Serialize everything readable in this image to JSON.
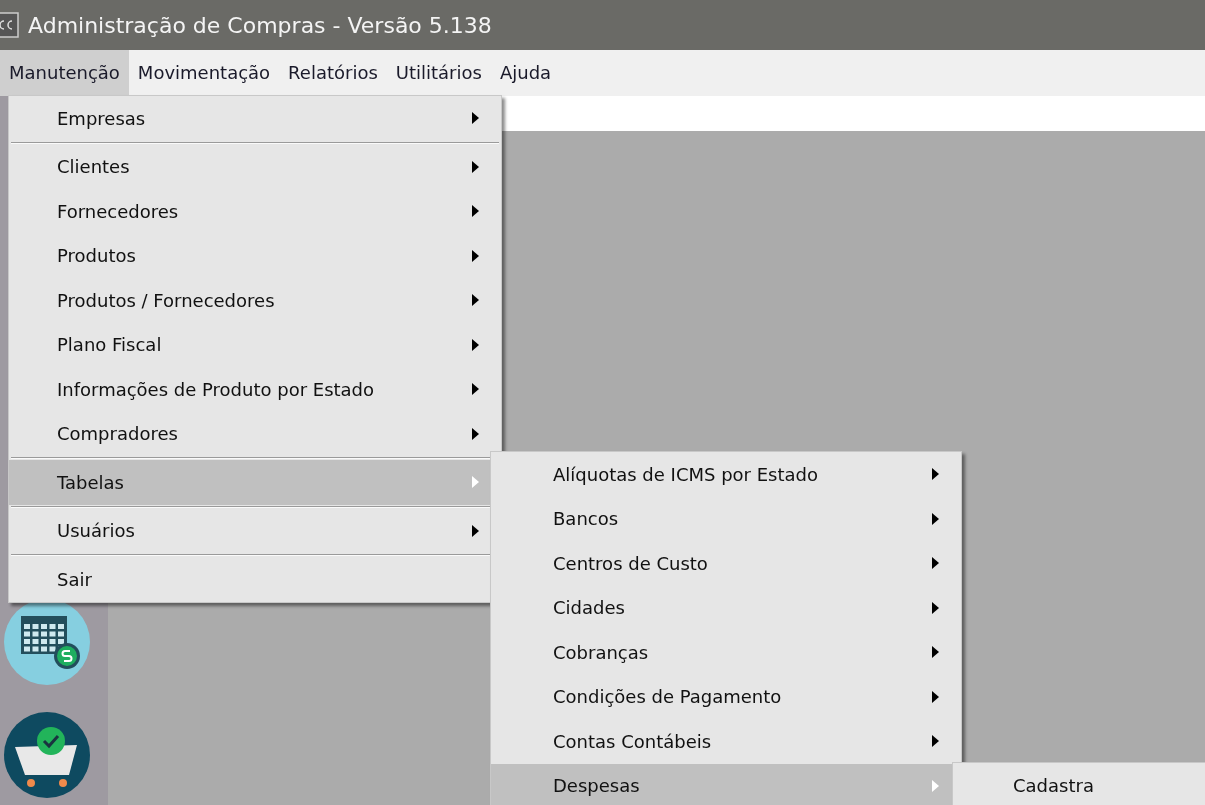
{
  "window": {
    "title": "Administração de Compras - Versão 5.138"
  },
  "menu_bar": [
    {
      "label": "Manutenção",
      "selected": true
    },
    {
      "label": "Movimentação",
      "selected": false
    },
    {
      "label": "Relatórios",
      "selected": false
    },
    {
      "label": "Utilitários",
      "selected": false
    },
    {
      "label": "Ajuda",
      "selected": false
    }
  ],
  "menu": [
    {
      "kind": "item",
      "label": "Empresas",
      "submenu": true,
      "selected": false
    },
    {
      "kind": "separator"
    },
    {
      "kind": "item",
      "label": "Clientes",
      "submenu": true,
      "selected": false
    },
    {
      "kind": "item",
      "label": "Fornecedores",
      "submenu": true,
      "selected": false
    },
    {
      "kind": "item",
      "label": "Produtos",
      "submenu": true,
      "selected": false
    },
    {
      "kind": "item",
      "label": "Produtos / Fornecedores",
      "submenu": true,
      "selected": false
    },
    {
      "kind": "item",
      "label": "Plano Fiscal",
      "submenu": true,
      "selected": false
    },
    {
      "kind": "item",
      "label": "Informações de Produto por Estado",
      "submenu": true,
      "selected": false
    },
    {
      "kind": "item",
      "label": "Compradores",
      "submenu": true,
      "selected": false
    },
    {
      "kind": "separator"
    },
    {
      "kind": "item",
      "label": "Tabelas",
      "submenu": true,
      "selected": true
    },
    {
      "kind": "separator"
    },
    {
      "kind": "item",
      "label": "Usuários",
      "submenu": true,
      "selected": false
    },
    {
      "kind": "separator"
    },
    {
      "kind": "item",
      "label": "Sair",
      "submenu": false,
      "selected": false
    }
  ],
  "submenu": [
    {
      "kind": "item",
      "label": "Alíquotas de ICMS por Estado",
      "submenu": true,
      "selected": false
    },
    {
      "kind": "item",
      "label": "Bancos",
      "submenu": true,
      "selected": false
    },
    {
      "kind": "item",
      "label": "Centros de Custo",
      "submenu": true,
      "selected": false
    },
    {
      "kind": "item",
      "label": "Cidades",
      "submenu": true,
      "selected": false
    },
    {
      "kind": "item",
      "label": "Cobranças",
      "submenu": true,
      "selected": false
    },
    {
      "kind": "item",
      "label": "Condições de Pagamento",
      "submenu": true,
      "selected": false
    },
    {
      "kind": "item",
      "label": "Contas Contábeis",
      "submenu": true,
      "selected": false
    },
    {
      "kind": "item",
      "label": "Despesas",
      "submenu": true,
      "selected": true
    }
  ],
  "sub_submenu": [
    {
      "kind": "item",
      "label": "Cadastra",
      "submenu": false,
      "selected": false
    }
  ]
}
